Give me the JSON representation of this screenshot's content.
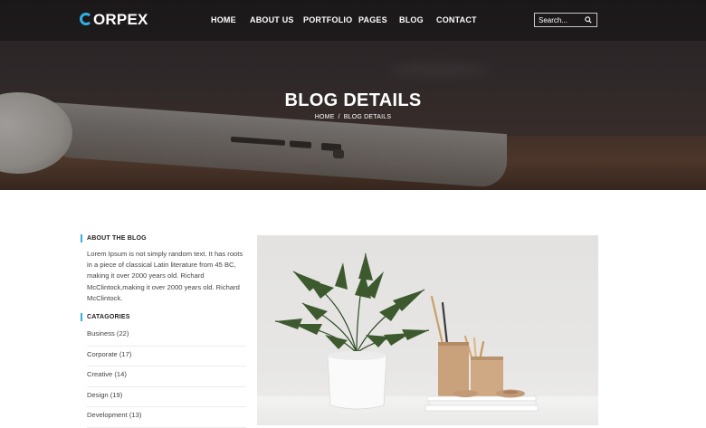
{
  "brand": {
    "logo_text": "ORPEX",
    "accent_color": "#2fb1e6"
  },
  "nav": {
    "items": [
      {
        "label": "HOME"
      },
      {
        "label": "ABOUT US"
      },
      {
        "label": "PORTFOLIO"
      },
      {
        "label": "PAGES"
      },
      {
        "label": "BLOG"
      },
      {
        "label": "CONTACT"
      }
    ]
  },
  "search": {
    "placeholder": "Search...",
    "icon": "search-icon"
  },
  "hero": {
    "title": "BLOG DETAILS",
    "breadcrumb": {
      "home": "HOME",
      "separator": "/",
      "current": "BLOG DETAILS"
    }
  },
  "sidebar": {
    "about": {
      "heading": "ABOUT THE BLOG",
      "text": "Lorem Ipsum is not simply random text. It has roots in a piece of classical Latin literature from 45 BC, making it over 2000 years old. Richard McClintock,making it over 2000 years old. Richard McClintock."
    },
    "categories": {
      "heading": "CATAGORIES",
      "items": [
        {
          "label": "Business (22)"
        },
        {
          "label": "Corporate (17)"
        },
        {
          "label": "Creative (14)"
        },
        {
          "label": "Design (19)"
        },
        {
          "label": "Development (13)"
        }
      ]
    }
  }
}
